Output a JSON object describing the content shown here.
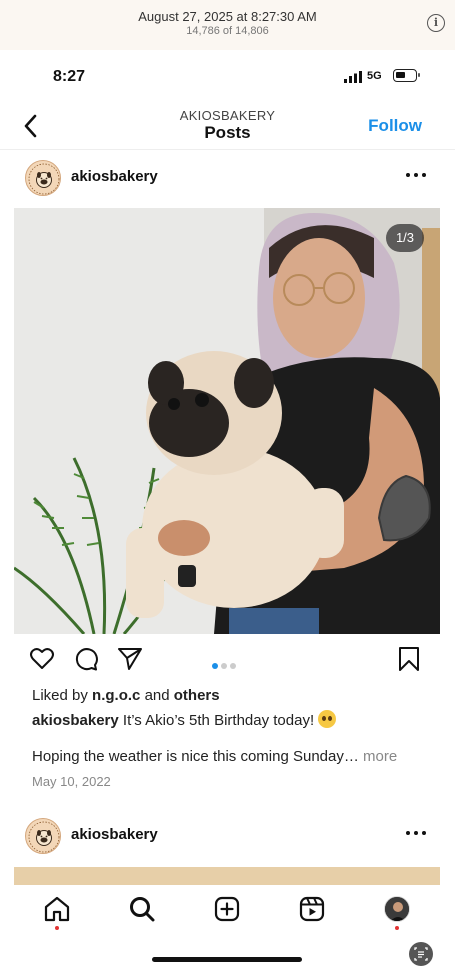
{
  "photos_app": {
    "date": "August 27, 2025 at 8:27:30 AM",
    "count": "14,786 of 14,806",
    "info_icon": "i"
  },
  "status_bar": {
    "time": "8:27",
    "network": "5G",
    "icons": [
      "signal-icon",
      "battery-icon"
    ]
  },
  "nav": {
    "username": "AKIOSBAKERY",
    "title": "Posts",
    "follow_label": "Follow",
    "back_icon": "chevron-left-icon"
  },
  "post": {
    "handle": "akiosbakery",
    "photo_counter": "1/3",
    "carousel": {
      "count": 3,
      "active": 0
    },
    "actions": [
      "heart-icon",
      "comment-icon",
      "share-icon",
      "bookmark-icon"
    ],
    "likes_prefix": "Liked by",
    "likes_user": "n.g.o.c",
    "likes_and": "and",
    "likes_others": "others",
    "caption_user": "akiosbakery",
    "caption_text": "It’s Akio’s 5th Birthday today!",
    "caption_more_text": "Hoping the weather is nice this coming Sunday…",
    "more_label": "more",
    "date": "May 10, 2022"
  },
  "next_post": {
    "handle": "akiosbakery"
  },
  "tabbar": {
    "tabs": [
      "home-icon",
      "search-icon",
      "create-icon",
      "reels-icon",
      "profile-icon"
    ]
  },
  "colors": {
    "accent": "#1b8fe8",
    "notification": "#e23434"
  }
}
